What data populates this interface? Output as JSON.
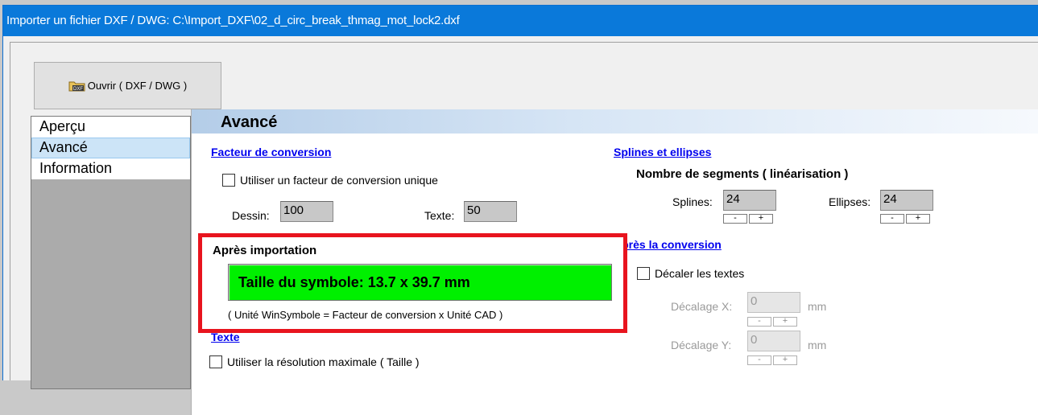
{
  "window": {
    "title": "Importer un fichier DXF / DWG: C:\\Import_DXF\\02_d_circ_break_thmag_mot_lock2.dxf"
  },
  "toolbar": {
    "open_label": "Ouvrir ( DXF / DWG )",
    "open_icon": "dxf-folder-icon"
  },
  "sidebar": {
    "items": [
      {
        "label": "Aperçu"
      },
      {
        "label": "Avancé"
      },
      {
        "label": "Information"
      }
    ],
    "selected": "Avancé"
  },
  "panel": {
    "title": "Avancé",
    "conversion": {
      "heading": "Facteur de conversion",
      "unique_label": "Utiliser un facteur de conversion unique",
      "drawing_label": "Dessin:",
      "drawing_value": "100",
      "text_label": "Texte:",
      "text_value": "50"
    },
    "splines": {
      "heading": "Splines et ellipses",
      "subheading": "Nombre de segments ( linéarisation )",
      "splines_label": "Splines:",
      "splines_value": "24",
      "ellipses_label": "Ellipses:",
      "ellipses_value": "24"
    },
    "after_conversion": {
      "heading": "Après la conversion",
      "shift_label": "Décaler les textes",
      "shift_x_label": "Décalage X:",
      "shift_x_value": "0",
      "shift_x_unit": "mm",
      "shift_y_label": "Décalage Y:",
      "shift_y_value": "0",
      "shift_y_unit": "mm"
    },
    "after_import": {
      "title": "Après importation",
      "size_text": "Taille du symbole: 13.7 x 39.7 mm",
      "note": "( Unité WinSymbole = Facteur de conversion x Unité CAD )"
    },
    "text": {
      "heading": "Texte",
      "max_res_label": "Utiliser la résolution maximale ( Taille )"
    },
    "spin": {
      "minus": "-",
      "plus": "+"
    }
  },
  "colors": {
    "titlebar": "#0a79da",
    "highlight_border": "#e8141e",
    "size_bar": "#00f000",
    "link": "#0000ee"
  }
}
